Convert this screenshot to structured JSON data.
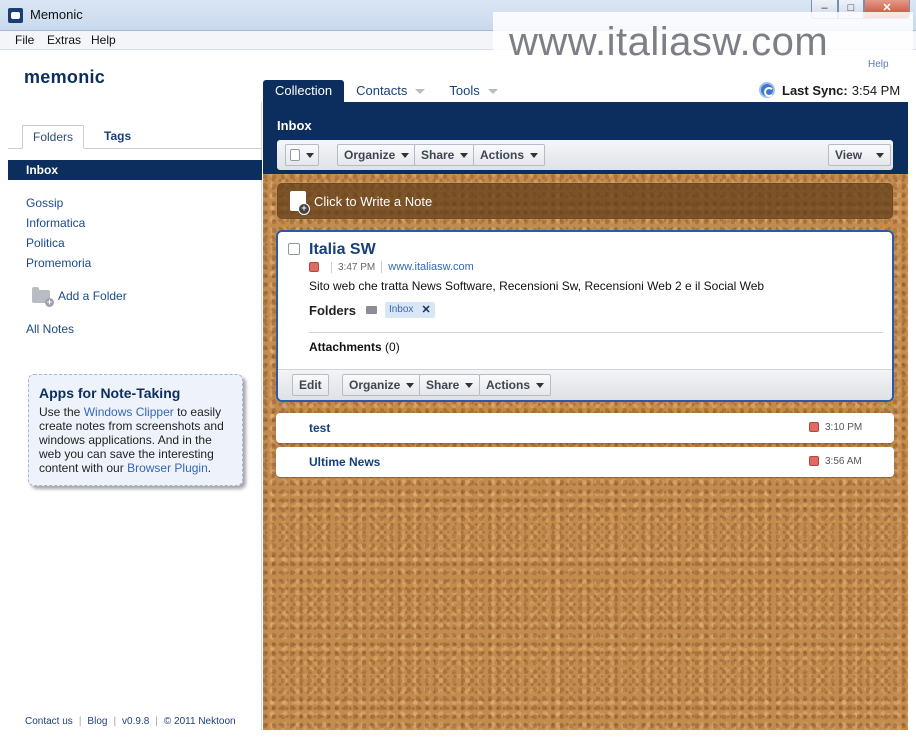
{
  "window": {
    "title": "Memonic",
    "minimize": "–",
    "maximize": "□",
    "close": "✕"
  },
  "menu": [
    "File",
    "Extras",
    "Help"
  ],
  "watermark": "www.italiasw.com",
  "header": {
    "logo": "memonic",
    "help": "Help",
    "tabs": [
      "Collection",
      "Contacts",
      "Tools"
    ],
    "sync_label": "Last Sync:",
    "sync_time": "3:54 PM"
  },
  "sidebar": {
    "tabs": [
      "Folders",
      "Tags"
    ],
    "inbox": "Inbox",
    "folders": [
      "Gossip",
      "Informatica",
      "Politica",
      "Promemoria"
    ],
    "add_folder": "Add a Folder",
    "all_notes": "All Notes",
    "promo": {
      "title": "Apps for Note-Taking",
      "t1": "Use the ",
      "link1": "Windows Clipper",
      "t2": " to easily create notes from screenshots and windows applications. And in the web you can save the interesting content with our ",
      "link2": "Browser Plugin",
      "t3": "."
    },
    "footer": [
      "Contact us",
      "Blog",
      "v0.9.8",
      "© 2011 Nektoon"
    ]
  },
  "main": {
    "title": "Inbox",
    "toolbar": {
      "organize": "Organize",
      "share": "Share",
      "actions": "Actions",
      "view": "View"
    },
    "write_note": "Click to Write a Note",
    "note": {
      "title": "Italia SW",
      "time": "3:47 PM",
      "url": "www.italiasw.com",
      "text": "Sito web che tratta News Software, Recensioni Sw, Recensioni Web 2 e il Social Web",
      "folders_label": "Folders",
      "folder_chip": "Inbox",
      "chip_remove": "✕",
      "attachments_label": "Attachments",
      "attachments_count": "(0)",
      "edit": "Edit",
      "organize": "Organize",
      "share": "Share",
      "actions": "Actions"
    },
    "notes": [
      {
        "title": "test",
        "time": "3:10 PM"
      },
      {
        "title": "Ultime News",
        "time": "3:56 AM"
      }
    ]
  },
  "colors": {
    "navy": "#0c2e5e",
    "cork": "#c48b4e",
    "link": "#3468b8"
  }
}
